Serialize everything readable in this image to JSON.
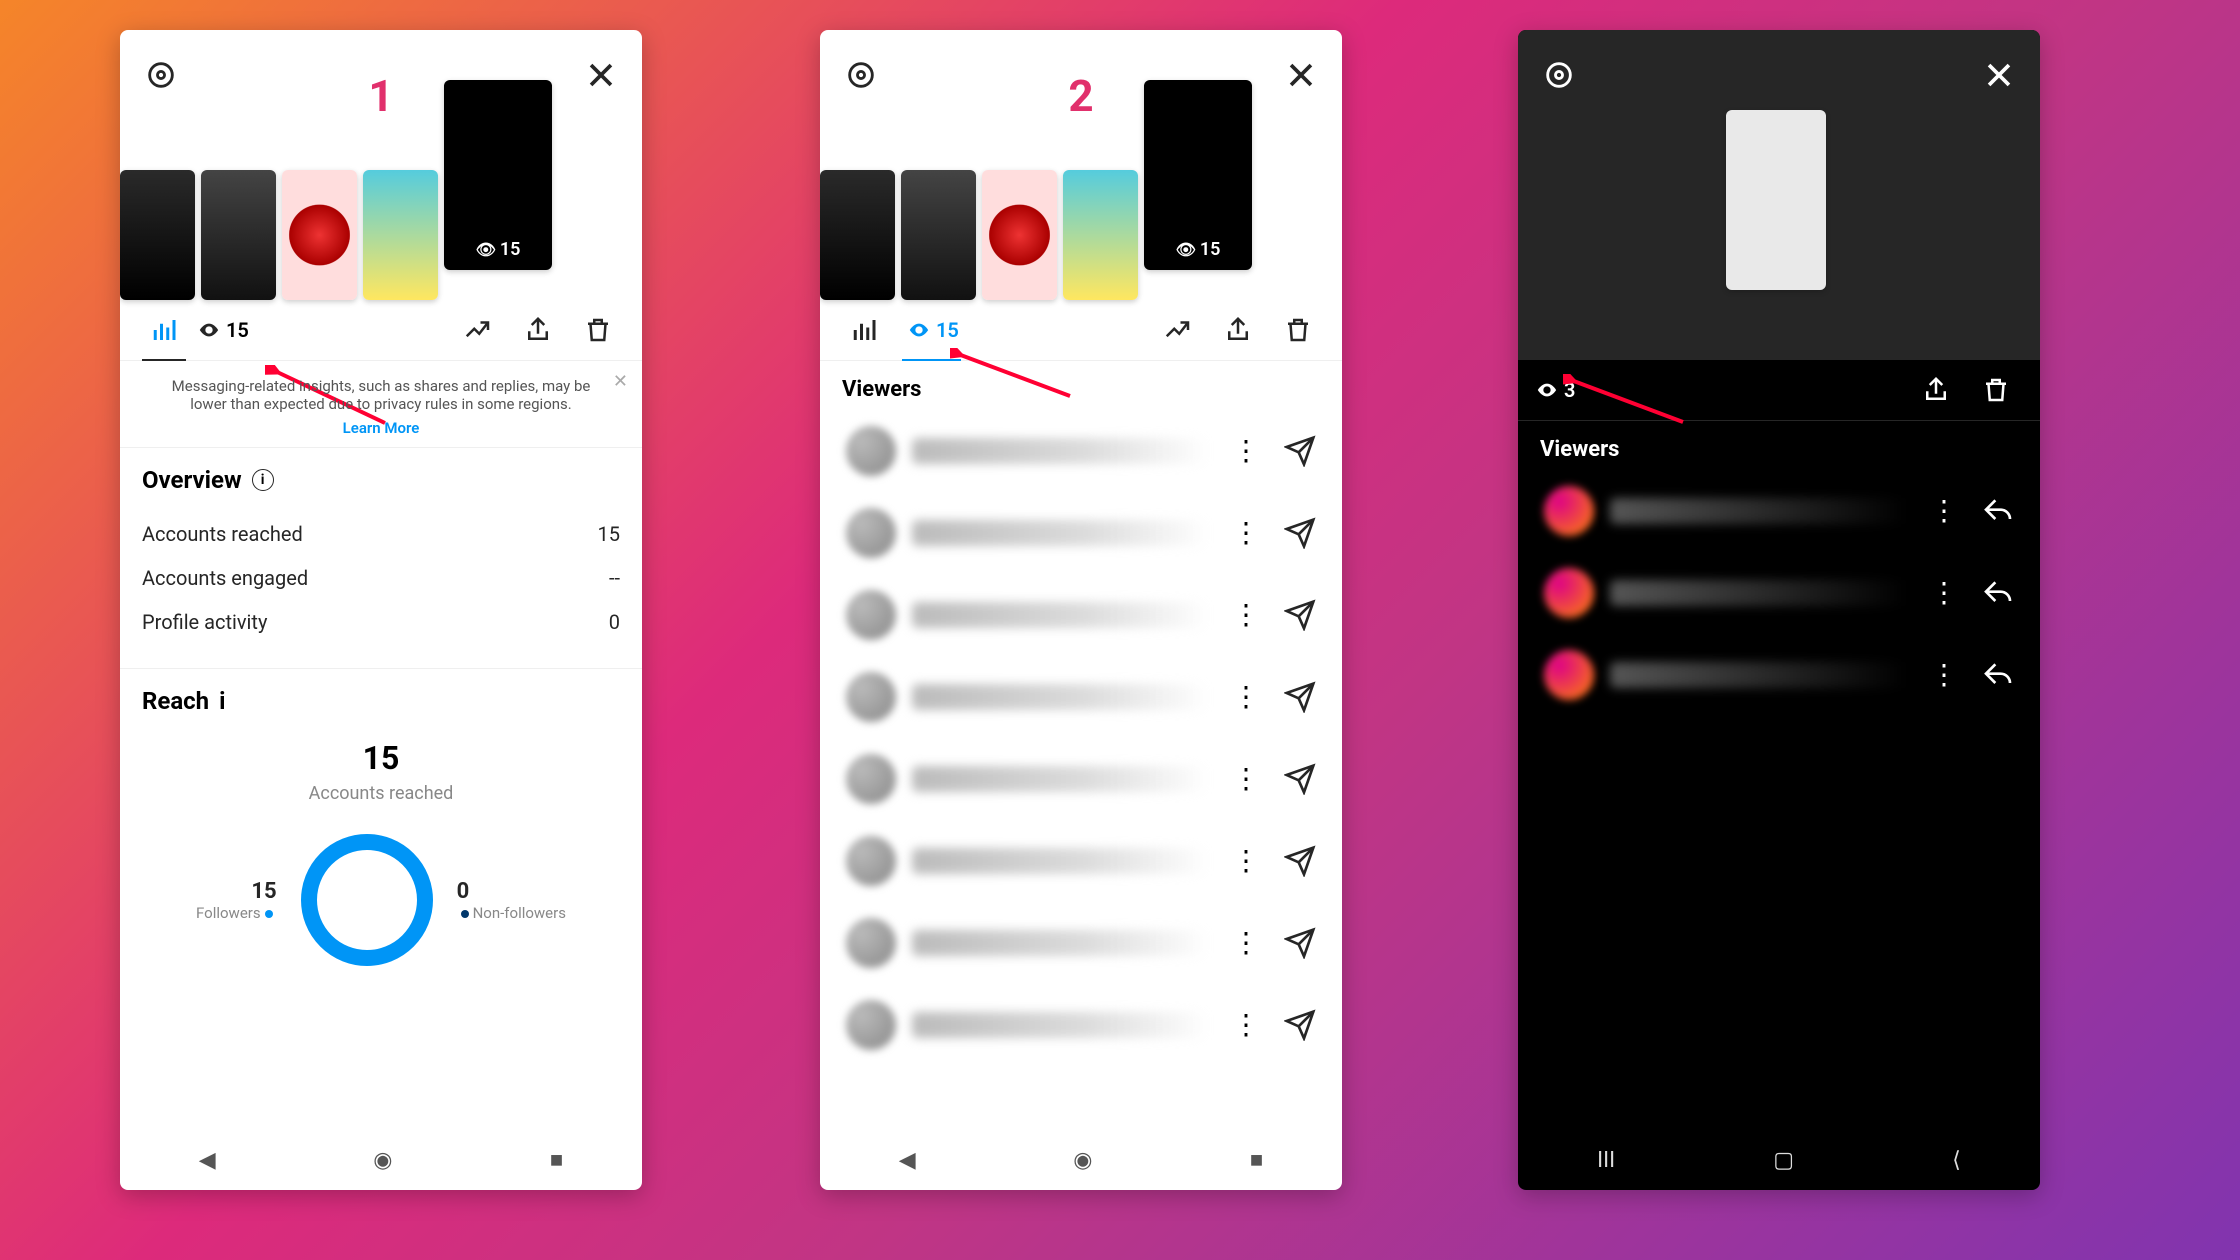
{
  "labels": {
    "1": "1",
    "2": "2",
    "3": "3"
  },
  "panel1": {
    "storyViews": "15",
    "tabViews": "15",
    "notice": "Messaging-related insights, such as shares and replies, may be lower than expected due to privacy rules in some regions.",
    "learnMore": "Learn More",
    "overviewTitle": "Overview",
    "rows": {
      "accountsReachedLabel": "Accounts reached",
      "accountsReachedVal": "15",
      "accountsEngagedLabel": "Accounts engaged",
      "accountsEngagedVal": "--",
      "profileActivityLabel": "Profile activity",
      "profileActivityVal": "0"
    },
    "reachTitle": "Reach",
    "reachBig": "15",
    "reachSub": "Accounts reached",
    "legend": {
      "followersN": "15",
      "followersL": "Followers",
      "nonFollowersN": "0",
      "nonFollowersL": "Non-followers"
    }
  },
  "panel2": {
    "storyViews": "15",
    "tabViews": "15",
    "viewersTitle": "Viewers",
    "viewerCount": 8
  },
  "panel3": {
    "tabViews": "3",
    "viewersTitle": "Viewers",
    "viewerCount": 3
  },
  "colors": {
    "accent": "#0095f6",
    "arrow": "#ff0033"
  },
  "chart_data": {
    "type": "pie",
    "title": "Reach — Accounts reached",
    "categories": [
      "Followers",
      "Non-followers"
    ],
    "values": [
      15,
      0
    ],
    "total": 15
  }
}
